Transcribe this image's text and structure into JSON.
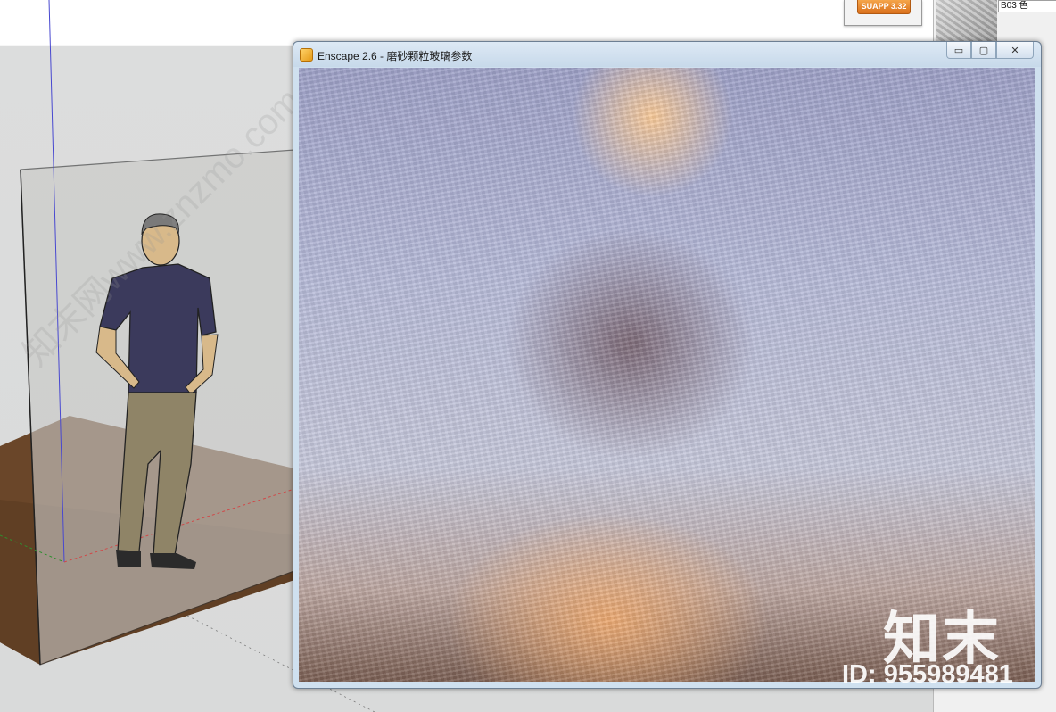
{
  "window": {
    "title": "Enscape 2.6 - 磨砂颗粒玻璃参数",
    "minimize_glyph": "▭",
    "maximize_glyph": "▢",
    "close_glyph": "✕"
  },
  "toolbar_badge": {
    "label": "SUAPP 3.32"
  },
  "materials_panel": {
    "material_name": "B03 色"
  },
  "watermark": {
    "logo_text": "知末",
    "id_text": "ID: 955989481",
    "site_text": "知末网www.znzmo.com"
  },
  "icons": [
    "enscape-app-icon",
    "minimize-icon",
    "maximize-icon",
    "close-icon"
  ],
  "colors": {
    "titlebar": "#c7d9ea",
    "floor": "#6f4a2c",
    "badge": "#e07a20"
  }
}
